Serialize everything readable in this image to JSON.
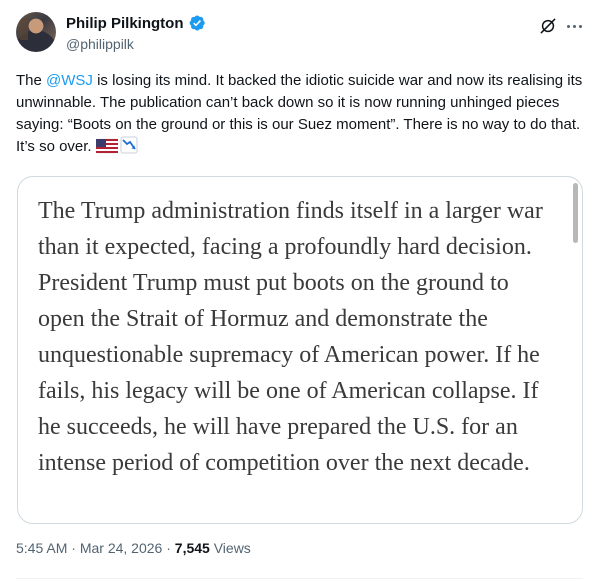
{
  "author": {
    "display_name": "Philip Pilkington",
    "handle": "@philippilk",
    "verified": true,
    "avatar": "avatar-photo"
  },
  "tweet": {
    "text_before_mention": "The ",
    "mention": "@WSJ",
    "text_after_mention": " is losing its mind. It backed the idiotic suicide war and now its realising its unwinnable. The publication can’t back down so it is now running unhinged pieces saying: “Boots on the ground or this is our Suez moment”. There is no way to do that. It’s so over. ",
    "emojis": [
      "us-flag-emoji",
      "chart-decreasing-emoji"
    ]
  },
  "quote_image_text": "The Trump administration finds itself in a larger war than it expected, facing a profoundly hard decision. President Trump must put boots on the ground to open the Strait of Hormuz and demonstrate the unquestionable supremacy of American power. If he fails, his legacy will be one of American collapse. If he succeeds, he will have prepared the U.S. for an intense period of competition over the next decade.",
  "meta": {
    "time": "5:45 AM",
    "separator": " · ",
    "date": "Mar 24, 2026",
    "views_count": "7,545",
    "views_label": " Views"
  },
  "colors": {
    "link": "#1d9bf0",
    "verified": "#1d9bf0",
    "secondary_text": "#536471",
    "border": "#cfd9de"
  },
  "icons": [
    "grok-icon",
    "more-icon",
    "verified-icon"
  ]
}
